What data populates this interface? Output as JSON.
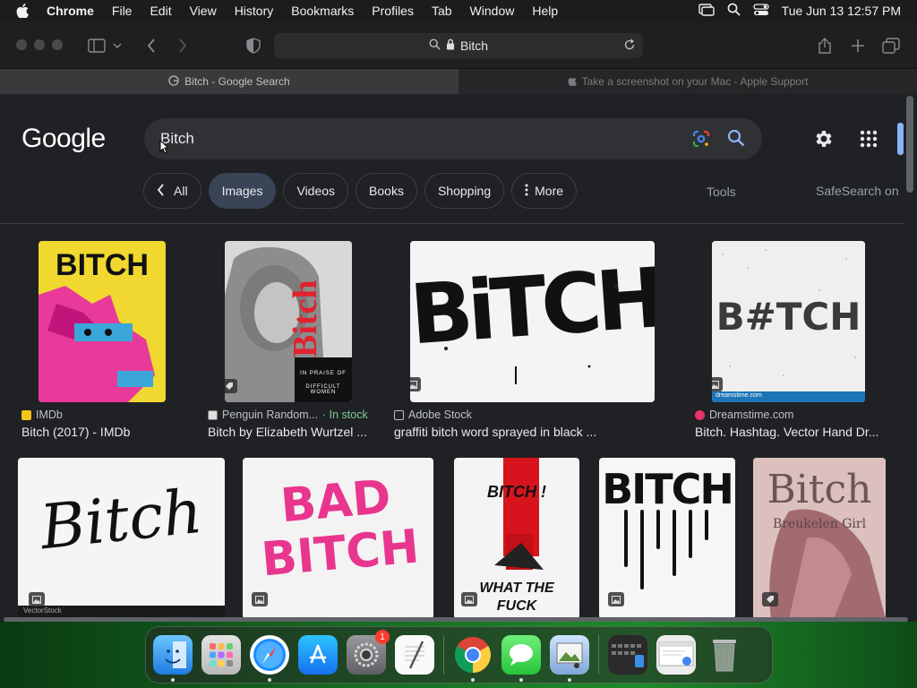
{
  "menubar": {
    "app": "Chrome",
    "items": [
      "File",
      "Edit",
      "View",
      "History",
      "Bookmarks",
      "Profiles",
      "Tab",
      "Window",
      "Help"
    ],
    "clock": "Tue Jun 13  12:57 PM"
  },
  "browser": {
    "url": "Bitch",
    "tabs": [
      {
        "label": "Bitch - Google Search",
        "active": true
      },
      {
        "label": "Take a screenshot on your Mac - Apple Support",
        "active": false
      }
    ]
  },
  "google": {
    "logo": "Google",
    "query": "Bitch",
    "chips": [
      "All",
      "Images",
      "Videos",
      "Books",
      "Shopping",
      "More"
    ],
    "selected_chip": "Images",
    "tools": "Tools",
    "safesearch": "SafeSearch on"
  },
  "results": [
    {
      "source": "IMDb",
      "title": "Bitch (2017) - IMDb",
      "thumb_text": "BITCH"
    },
    {
      "source": "Penguin Random...",
      "instock": "· In stock",
      "title": "Bitch by Elizabeth Wurtzel ...",
      "thumb_text": "Bitch",
      "thumb_sub1": "IN PRAISE OF",
      "thumb_sub2": "DIFFICULT WOMEN"
    },
    {
      "source": "Adobe Stock",
      "title": "graffiti bitch word sprayed in black ...",
      "thumb_text": "BiTCH"
    },
    {
      "source": "Dreamstime.com",
      "title": "Bitch. Hashtag. Vector Hand Dr...",
      "thumb_text": "B#TCH",
      "thumb_caption": "dreamstime.com"
    }
  ],
  "row2": [
    {
      "thumb_text": "Bitch",
      "thumb_caption": "VectorStock"
    },
    {
      "thumb_text": "BAD BITCH"
    },
    {
      "thumb_text": "BITCH !",
      "thumb_sub": "WHAT THE FUCK"
    },
    {
      "thumb_text": "BITCH"
    },
    {
      "thumb_text": "Bitch",
      "thumb_sub": "Breukelen Girl"
    }
  ],
  "dock": {
    "apps": [
      "Finder",
      "Launchpad",
      "Safari",
      "App Store",
      "System Settings",
      "TextEdit",
      "Chrome",
      "Messages",
      "Preview"
    ],
    "settings_badge": "1"
  },
  "colors": {
    "accent": "#8ab4f8",
    "chip_selected": "#394457",
    "page_bg": "#202124",
    "instock": "#81c995"
  }
}
